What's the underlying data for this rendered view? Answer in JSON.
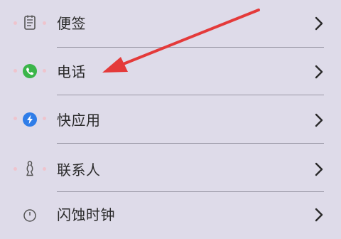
{
  "settings_list": {
    "items": [
      {
        "label": "便签",
        "icon": "notes-icon"
      },
      {
        "label": "电话",
        "icon": "phone-icon"
      },
      {
        "label": "快应用",
        "icon": "quick-app-icon"
      },
      {
        "label": "联系人",
        "icon": "contacts-icon"
      },
      {
        "label": "闪蚀时钟",
        "icon": "clock-icon"
      }
    ]
  },
  "annotation": {
    "arrow_color": "#e43a3a",
    "points_to": "电话"
  },
  "colors": {
    "background": "#dedbe9",
    "phone_icon": "#3bb54a",
    "quick_app_icon": "#2f7de8"
  }
}
